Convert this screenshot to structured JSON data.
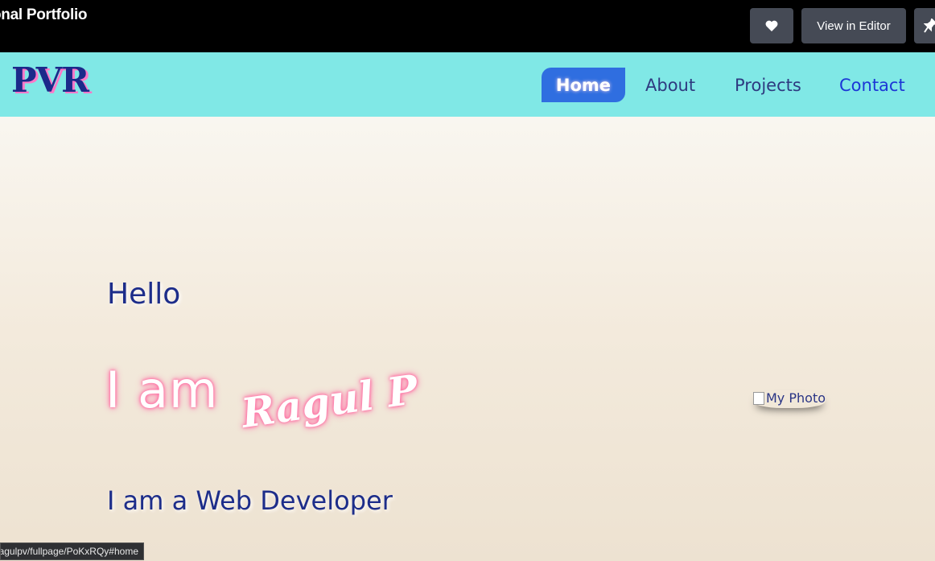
{
  "topbar": {
    "title": "onal Portfolio",
    "heart_icon": "heart-icon",
    "editor_label": "View in Editor",
    "pin_icon": "pin-icon"
  },
  "nav": {
    "logo": "PVR",
    "items": [
      {
        "label": "Home",
        "active": true
      },
      {
        "label": "About"
      },
      {
        "label": "Projects"
      },
      {
        "label": "Contact"
      }
    ]
  },
  "hero": {
    "greeting": "Hello",
    "intro": "I am",
    "name": "Ragul P",
    "role": "I am a Web Developer",
    "photo_alt": "My Photo"
  },
  "status_url": "agulpv/fullpage/PoKxRQy#home",
  "colors": {
    "nav_bg": "#80e8e6",
    "active_tab": "#2f6ee0",
    "text_blue": "#1d2d8a",
    "neon_pink": "#ff6fa3"
  }
}
